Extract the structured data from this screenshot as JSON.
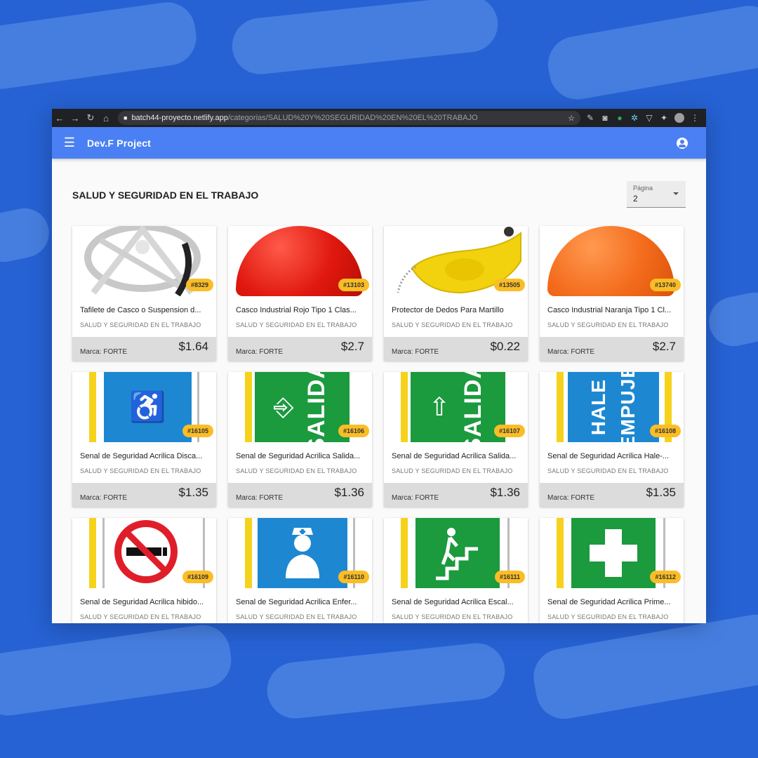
{
  "browser": {
    "url_host": "batch44-proyecto.netlify.app",
    "url_path": "/categorias/SALUD%20Y%20SEGURIDAD%20EN%20EL%20TRABAJO"
  },
  "app": {
    "title": "Dev.F Project"
  },
  "page": {
    "title": "SALUD Y SEGURIDAD EN EL TRABAJO",
    "page_select_label": "Página",
    "page_select_value": "2"
  },
  "products": [
    {
      "id": "#8329",
      "name": "Tafilete de Casco o Suspension d...",
      "category": "SALUD Y SEGURIDAD EN EL TRABAJO",
      "brand": "Marca: FORTE",
      "price": "$1.64",
      "art": "suspension"
    },
    {
      "id": "#13103",
      "name": "Casco Industrial Rojo Tipo 1 Clas...",
      "category": "SALUD Y SEGURIDAD EN EL TRABAJO",
      "brand": "Marca: FORTE",
      "price": "$2.7",
      "art": "helmet-red"
    },
    {
      "id": "#13505",
      "name": "Protector de Dedos Para Martillo",
      "category": "SALUD Y SEGURIDAD EN EL TRABAJO",
      "brand": "Marca: FORTE",
      "price": "$0.22",
      "art": "finger-guard"
    },
    {
      "id": "#13740",
      "name": "Casco Industrial Naranja Tipo 1 Cl...",
      "category": "SALUD Y SEGURIDAD EN EL TRABAJO",
      "brand": "Marca: FORTE",
      "price": "$2.7",
      "art": "helmet-orange"
    },
    {
      "id": "#16105",
      "name": "Senal de Seguridad Acrilica Disca...",
      "category": "SALUD Y SEGURIDAD EN EL TRABAJO",
      "brand": "Marca: FORTE",
      "price": "$1.35",
      "art": "sign-accessible"
    },
    {
      "id": "#16106",
      "name": "Senal de Seguridad Acrilica Salida...",
      "category": "SALUD Y SEGURIDAD EN EL TRABAJO",
      "brand": "Marca: FORTE",
      "price": "$1.36",
      "art": "sign-exit-1"
    },
    {
      "id": "#16107",
      "name": "Senal de Seguridad Acrilica Salida...",
      "category": "SALUD Y SEGURIDAD EN EL TRABAJO",
      "brand": "Marca: FORTE",
      "price": "$1.36",
      "art": "sign-exit-2"
    },
    {
      "id": "#16108",
      "name": "Senal de Seguridad Acrilica Hale-...",
      "category": "SALUD Y SEGURIDAD EN EL TRABAJO",
      "brand": "Marca: FORTE",
      "price": "$1.35",
      "art": "sign-hale"
    },
    {
      "id": "#16109",
      "name": "Senal de Seguridad Acrilica hibido...",
      "category": "SALUD Y SEGURIDAD EN EL TRABAJO",
      "brand": "",
      "price": "",
      "art": "sign-no-smoking"
    },
    {
      "id": "#16110",
      "name": "Senal de Seguridad Acrilica Enfer...",
      "category": "SALUD Y SEGURIDAD EN EL TRABAJO",
      "brand": "",
      "price": "",
      "art": "sign-nurse"
    },
    {
      "id": "#16111",
      "name": "Senal de Seguridad Acrilica Escal...",
      "category": "SALUD Y SEGURIDAD EN EL TRABAJO",
      "brand": "",
      "price": "",
      "art": "sign-stairs"
    },
    {
      "id": "#16112",
      "name": "Senal de Seguridad Acrilica Prime...",
      "category": "SALUD Y SEGURIDAD EN EL TRABAJO",
      "brand": "",
      "price": "",
      "art": "sign-first-aid"
    }
  ],
  "colors": {
    "background": "#2662d4",
    "appbar": "#4a80f3",
    "badge": "#fbbd26",
    "footer": "#dcdcdc"
  },
  "icons": {
    "menu": "menu-icon",
    "account": "account-icon",
    "lock": "lock-icon"
  },
  "art_text": {
    "salida": "SALIDA",
    "hale": "HALE",
    "empuje": "EMPUJE"
  }
}
